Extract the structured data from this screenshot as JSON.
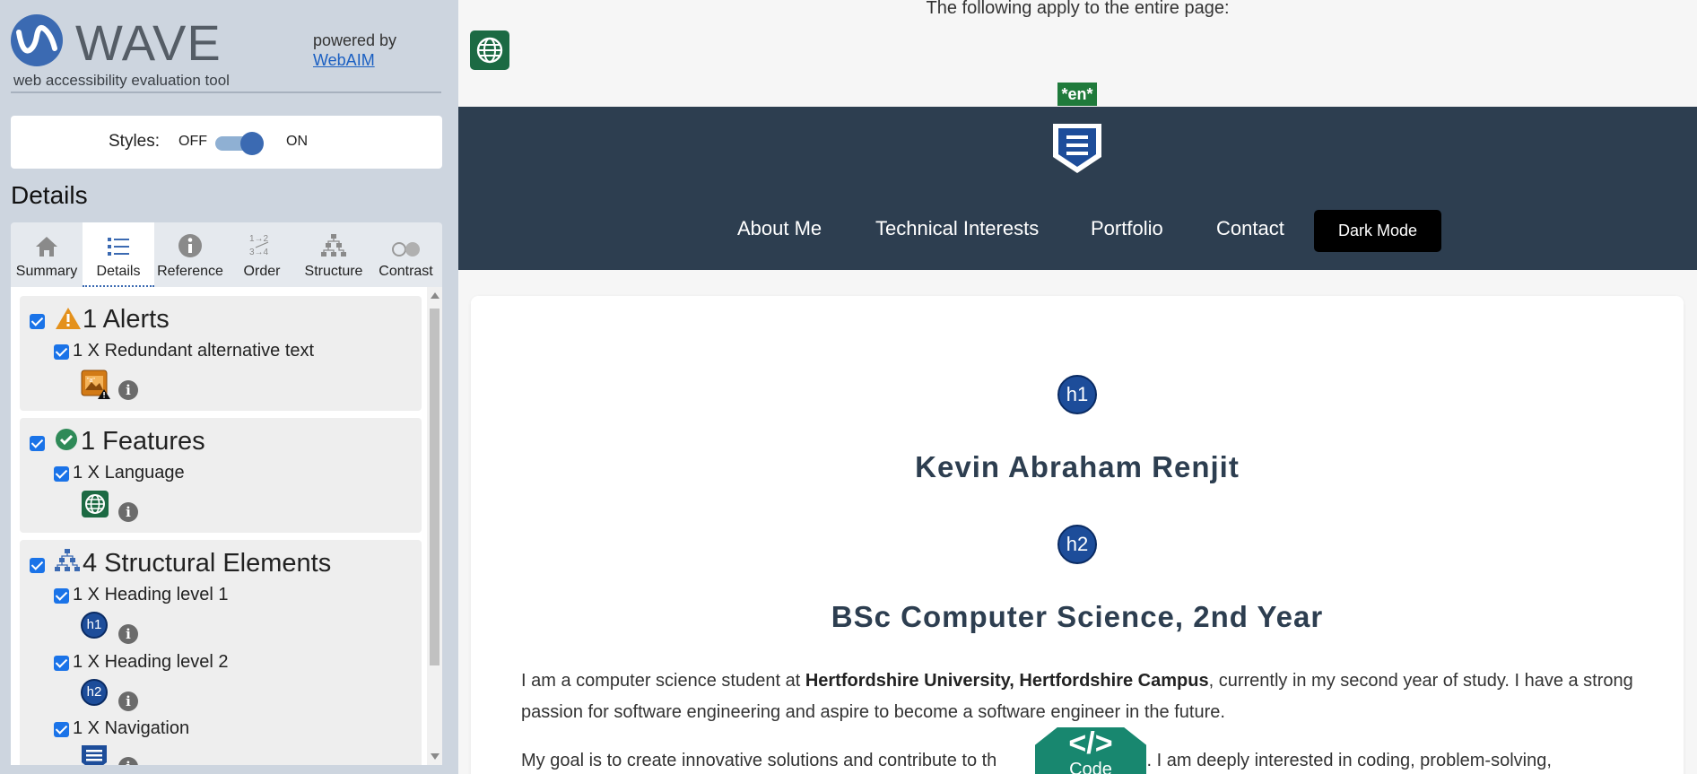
{
  "wave": {
    "title": "WAVE",
    "subtitle": "web accessibility evaluation tool",
    "powered_by": "powered by",
    "webaim_link": "WebAIM",
    "styles_label": "Styles:",
    "styles_off": "OFF",
    "styles_on": "ON",
    "styles_enabled": true,
    "details_heading": "Details",
    "tabs": [
      {
        "label": "Summary",
        "icon": "home-icon"
      },
      {
        "label": "Details",
        "icon": "list-icon",
        "active": true
      },
      {
        "label": "Reference",
        "icon": "info-icon"
      },
      {
        "label": "Order",
        "icon": "order-icon"
      },
      {
        "label": "Structure",
        "icon": "structure-icon"
      },
      {
        "label": "Contrast",
        "icon": "contrast-icon"
      }
    ],
    "groups": {
      "alerts": {
        "title": "1 Alerts",
        "item": "1 X Redundant alternative text"
      },
      "features": {
        "title": "1 Features",
        "item": "1 X Language"
      },
      "structure": {
        "title": "4 Structural Elements",
        "items": [
          "1 X Heading level 1",
          "1 X Heading level 2",
          "1 X Navigation"
        ],
        "badges": [
          "h1",
          "h2"
        ]
      }
    }
  },
  "page": {
    "apply_text": "The following apply to the entire page:",
    "lang_tag": "*en*",
    "nav": [
      "About Me",
      "Technical Interests",
      "Portfolio",
      "Contact"
    ],
    "dark_mode": "Dark Mode",
    "badges": [
      "h1",
      "h2"
    ],
    "h1": "Kevin Abraham Renjit",
    "h2": "BSc Computer Science, 2nd Year",
    "para1": {
      "pre": "I am a computer science student at ",
      "bold": "Hertfordshire University, Hertfordshire Campus",
      "post": ", currently in my second year of study. I have a strong passion for software engineering and aspire to become a software engineer in the future."
    },
    "para2_a": "My goal is to create innovative solutions and contribute to th",
    "para2_b": "y field. I am deeply interested in coding, problem-solving,",
    "code_symbol": "</>",
    "code_label": "Code"
  },
  "colors": {
    "sidebar_bg": "#cdd5df",
    "wave_blue": "#3b6ab2",
    "nav_bg": "#2d3e50",
    "feature_green": "#1c6a43",
    "code_teal": "#18876f"
  }
}
